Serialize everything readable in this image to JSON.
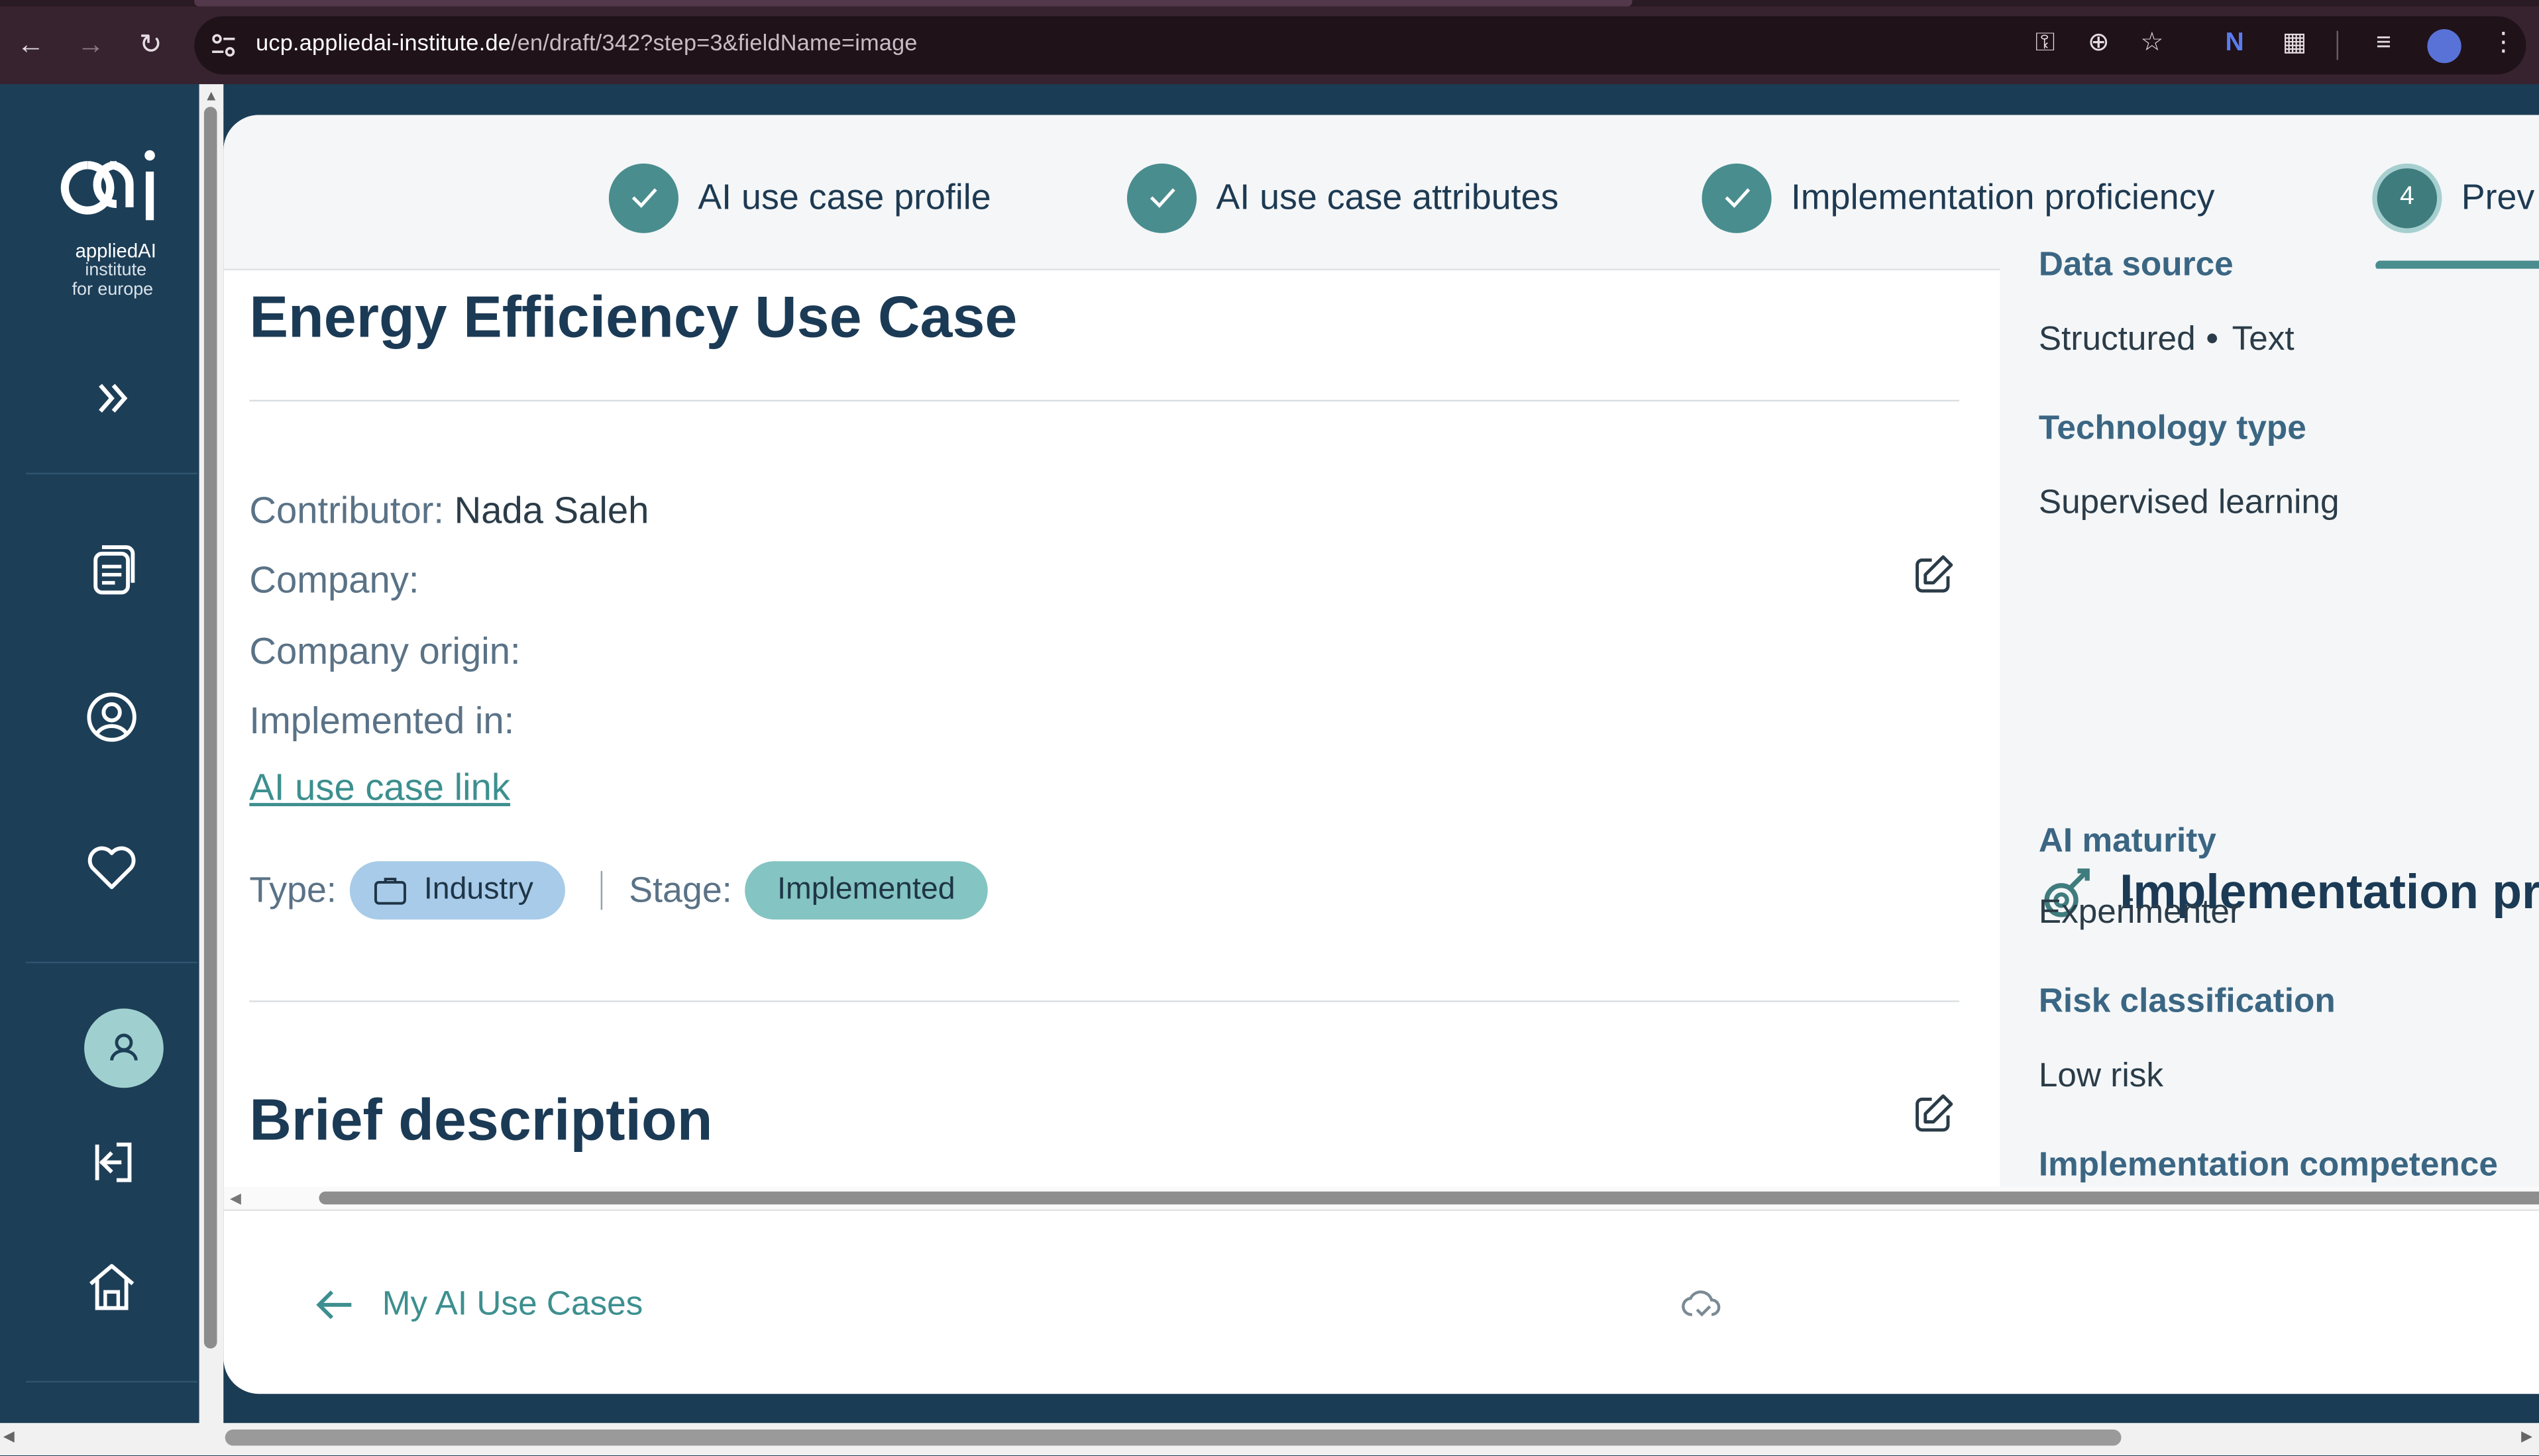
{
  "browser": {
    "url_domain": "ucp.appliedai-institute.de",
    "url_path": "/en/draft/342?step=3&fieldName=image"
  },
  "sidebar": {
    "logo_text": "appliedAI",
    "logo_sub1": "institute",
    "logo_sub2": "for europe"
  },
  "stepper": {
    "steps": [
      {
        "label": "AI use case profile"
      },
      {
        "label": "AI use case attributes"
      },
      {
        "label": "Implementation proficiency"
      },
      {
        "number": "4",
        "label": "Prev"
      }
    ]
  },
  "main": {
    "title": "Energy Efficiency Use Case",
    "contributor_label": "Contributor:",
    "contributor_value": "Nada Saleh",
    "company_label": "Company:",
    "company_origin_label": "Company origin:",
    "implemented_in_label": "Implemented in:",
    "link_text": "AI use case link",
    "type_label": "Type:",
    "type_value": "Industry",
    "stage_label": "Stage:",
    "stage_value": "Implemented",
    "section_title": "Brief description"
  },
  "right": {
    "data_source_label": "Data source",
    "data_source_values": [
      "Structured",
      "Text"
    ],
    "technology_label": "Technology type",
    "technology_value": "Supervised learning",
    "impl_heading": "Implementation pr",
    "ai_maturity_label": "AI maturity",
    "ai_maturity_value": "Experimenter",
    "risk_label": "Risk classification",
    "risk_value": "Low risk",
    "competence_label": "Implementation competence"
  },
  "footer": {
    "back_label": "My AI Use Cases"
  },
  "colors": {
    "sidebar": "#1d3e57",
    "accent": "#4a8d8e",
    "heading": "#1b3a55",
    "chip_industry": "#a7cbe8",
    "chip_stage": "#84c4c2"
  }
}
